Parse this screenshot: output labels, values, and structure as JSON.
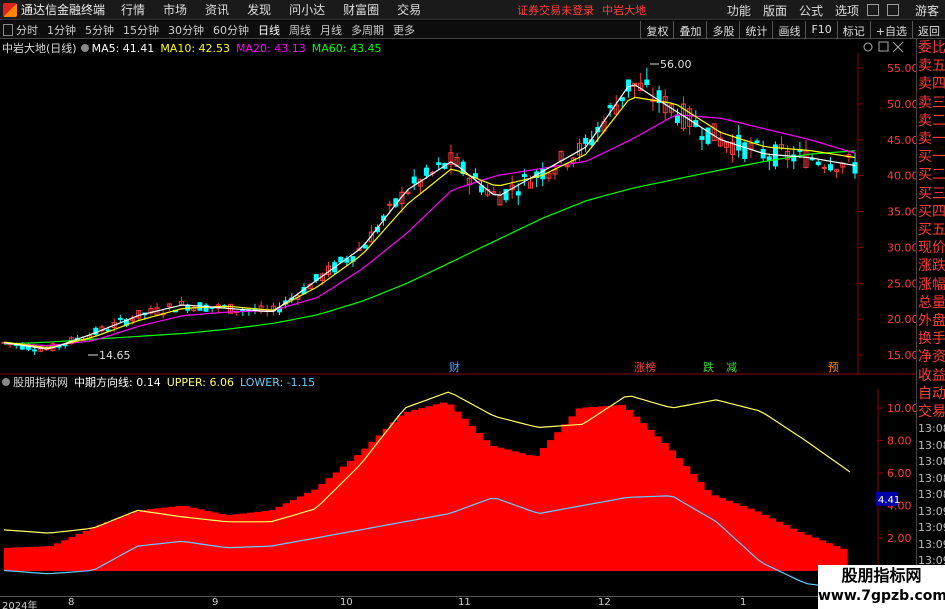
{
  "menubar": {
    "app_title": "通达信金融终端",
    "items": [
      "行情",
      "市场",
      "资讯",
      "发现",
      "问小达",
      "财富圈",
      "交易"
    ],
    "login_status": "证券交易未登录",
    "stock_name": "中岩大地",
    "right_items": [
      "功能",
      "版面",
      "公式",
      "选项"
    ],
    "guest": "游客"
  },
  "toolbar": {
    "periods": [
      "分时",
      "1分钟",
      "5分钟",
      "15分钟",
      "30分钟",
      "60分钟",
      "日线",
      "周线",
      "月线",
      "多周期",
      "更多"
    ],
    "active_period": "日线",
    "buttons": [
      "复权",
      "叠加",
      "多股",
      "统计",
      "画线",
      "F10",
      "标记",
      "+自选",
      "返回"
    ]
  },
  "main_chart": {
    "title": "中岩大地(日线)",
    "ma5_label": "MA5: 41.41",
    "ma10_label": "MA10: 42.53",
    "ma20_label": "MA20: 43.13",
    "ma60_label": "MA60: 43.45",
    "colors": {
      "ma5": "#ffffff",
      "ma10": "#ffff00",
      "ma20": "#ff00ff",
      "ma60": "#00ff00",
      "up": "#ff3b3b",
      "down": "#00ffff"
    },
    "high_label": "56.00",
    "low_label": "14.65",
    "markers": [
      {
        "text": "财",
        "color": "#4aa3ff"
      },
      {
        "text": "涨榜",
        "color": "#ff4444"
      },
      {
        "text": "跌",
        "color": "#33dd33"
      },
      {
        "text": "减",
        "color": "#33dd33"
      },
      {
        "text": "预",
        "color": "#ff8800"
      }
    ]
  },
  "sub_chart": {
    "title": "股朋指标网",
    "mid_label": "中期方向线: 0.14",
    "upper_label": "UPPER: 6.06",
    "lower_label": "LOWER: -1.15",
    "current_value": "4.41"
  },
  "chart_data": [
    {
      "type": "line",
      "title": "中岩大地(日线)",
      "y_ticks": [
        "55.00",
        "50.00",
        "45.00",
        "40.00",
        "35.00",
        "30.00",
        "25.00",
        "20.00",
        "15.00"
      ],
      "ylim": [
        13,
        58
      ],
      "series": [
        {
          "name": "MA60",
          "values": [
            16.5,
            16.8,
            17.2,
            17.6,
            18.0,
            18.6,
            19.4,
            20.6,
            22.5,
            25.0,
            28.0,
            31.0,
            34.0,
            36.5,
            38.2,
            39.5,
            40.8,
            42.0,
            43.0,
            43.45
          ]
        },
        {
          "name": "MA20",
          "values": [
            16.6,
            16.3,
            17.0,
            19.0,
            20.5,
            21.0,
            21.2,
            23.0,
            27.0,
            32.0,
            38.0,
            40.0,
            41.0,
            42.0,
            45.0,
            48.5,
            48.0,
            46.5,
            45.0,
            43.13
          ]
        },
        {
          "name": "MA10",
          "values": [
            16.8,
            16.0,
            17.5,
            19.8,
            21.5,
            21.8,
            21.2,
            24.5,
            29.0,
            36.0,
            41.0,
            38.5,
            40.0,
            43.0,
            51.0,
            50.0,
            46.0,
            44.0,
            43.5,
            42.53
          ]
        },
        {
          "name": "MA5",
          "values": [
            16.7,
            15.8,
            18.0,
            20.5,
            22.0,
            21.5,
            21.0,
            25.5,
            30.0,
            38.0,
            42.0,
            37.0,
            40.5,
            44.0,
            53.0,
            49.0,
            45.0,
            43.0,
            42.5,
            41.41
          ]
        }
      ],
      "month_labels": [
        "2024年",
        "8",
        "9",
        "10",
        "11",
        "12",
        "1"
      ]
    },
    {
      "type": "area",
      "title": "股朋指标网",
      "y_ticks": [
        "10.00",
        "8.00",
        "6.00",
        "4.00",
        "2.00"
      ],
      "ylim": [
        -1.5,
        12
      ],
      "series": [
        {
          "name": "中期方向线",
          "values": [
            0.2,
            0.3,
            1.5,
            2.5,
            2.8,
            2.2,
            2.5,
            3.8,
            6.0,
            8.5,
            9.2,
            6.5,
            5.8,
            8.8,
            9.0,
            6.5,
            3.5,
            2.5,
            1.2,
            0.14
          ]
        },
        {
          "name": "UPPER",
          "values": [
            2.5,
            2.3,
            2.6,
            3.7,
            3.3,
            3.0,
            3.0,
            3.8,
            6.5,
            10.0,
            11.0,
            9.5,
            8.8,
            9.0,
            10.8,
            10.0,
            10.5,
            9.8,
            8.0,
            6.06
          ]
        },
        {
          "name": "LOWER",
          "values": [
            0.0,
            -0.2,
            0.0,
            1.5,
            1.8,
            1.4,
            1.5,
            2.0,
            2.5,
            3.0,
            3.5,
            4.5,
            3.5,
            4.0,
            4.5,
            4.6,
            3.0,
            0.5,
            -0.8,
            -1.15
          ]
        }
      ]
    }
  ],
  "right_panel": {
    "tabs": [
      "委比",
      "卖五",
      "卖四",
      "卖三",
      "卖二",
      "卖一",
      "买一",
      "买二",
      "买三",
      "买四",
      "买五",
      "现价",
      "涨跌",
      "涨幅",
      "总量",
      "外盘",
      "换手",
      "净资",
      "收益"
    ],
    "sub_tabs": [
      "自动",
      "交易"
    ],
    "times": [
      "13:08",
      "13:08",
      "13:08",
      "13:08",
      "13:08",
      "13:09",
      "13:09",
      "13:09",
      "13:09"
    ]
  },
  "watermark": {
    "line1": "股朋指标网",
    "line2": "www.7gpzb.com"
  }
}
